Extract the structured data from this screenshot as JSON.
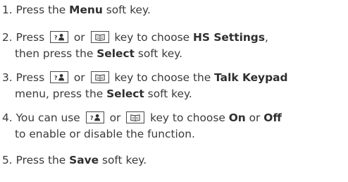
{
  "steps": [
    {
      "lines": [
        [
          {
            "t": "1. Press the "
          },
          {
            "b": "Menu"
          },
          {
            "t": " soft key."
          }
        ]
      ]
    },
    {
      "lines": [
        [
          {
            "t": "2. Press "
          },
          {
            "icon": "contacts-key-icon"
          },
          {
            "t": " or "
          },
          {
            "icon": "phonebook-key-icon"
          },
          {
            "t": " key to choose "
          },
          {
            "b": "HS Settings"
          },
          {
            "t": ","
          }
        ],
        [
          {
            "t": "then press the "
          },
          {
            "b": "Select"
          },
          {
            "t": " soft key."
          }
        ]
      ]
    },
    {
      "lines": [
        [
          {
            "t": "3. Press "
          },
          {
            "icon": "contacts-key-icon"
          },
          {
            "t": " or "
          },
          {
            "icon": "phonebook-key-icon"
          },
          {
            "t": " key to choose the "
          },
          {
            "b": "Talk Keypad"
          }
        ],
        [
          {
            "t": "menu, press the "
          },
          {
            "b": "Select"
          },
          {
            "t": " soft key."
          }
        ]
      ]
    },
    {
      "lines": [
        [
          {
            "t": "4. You can use "
          },
          {
            "icon": "contacts-key-icon"
          },
          {
            "t": " or "
          },
          {
            "icon": "phonebook-key-icon"
          },
          {
            "t": " key to choose "
          },
          {
            "b": "On"
          },
          {
            "t": " or "
          },
          {
            "b": "Off"
          }
        ],
        [
          {
            "t": "to enable or disable the function."
          }
        ]
      ]
    },
    {
      "lines": [
        [
          {
            "t": "5. Press the "
          },
          {
            "b": "Save"
          },
          {
            "t": " soft key."
          }
        ]
      ]
    }
  ]
}
